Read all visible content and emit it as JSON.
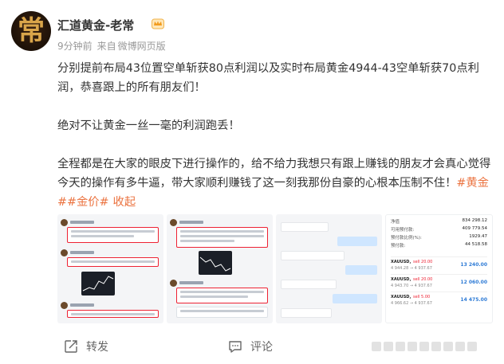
{
  "post": {
    "author": {
      "name": "汇道黄金-老常",
      "avatar_glyph": "常",
      "avatar_color": "#1d1108",
      "badge_icon": "vip-crown-icon"
    },
    "meta": {
      "time": "9分钟前",
      "source_prefix": "来自",
      "source": "微博网页版"
    },
    "paragraphs": [
      "分别提前布局43位置空单斩获80点利润以及实时布局黄金4944-43空单斩获70点利润，恭喜跟上的所有朋友们！",
      "绝对不让黄金一丝一毫的利润跑丢！",
      "全程都是在大家的眼皮下进行操作的，给不给力我想只有跟上赚钱的朋友才会真心觉得今天的操作有多牛逼，带大家顺利赚钱了这一刻我那份自豪的心根本压制不住！"
    ],
    "tags": [
      "#黄金#",
      "#金价#"
    ],
    "collapse_label": "收起",
    "accent_color": "#eb7340",
    "images": [
      {
        "kind": "chat-screenshot"
      },
      {
        "kind": "chat-screenshot"
      },
      {
        "kind": "chat-screenshot"
      },
      {
        "kind": "trading-account-screenshot",
        "account_rows": [
          {
            "key": "净值",
            "value": "834 298.12"
          },
          {
            "key": "可用预付款:",
            "value": "409 779.54"
          },
          {
            "key": "预付款比例(%):",
            "value": "1929.47"
          },
          {
            "key": "预付款:",
            "value": "44 518.58"
          }
        ],
        "positions": [
          {
            "symbol": "XAUUSD,",
            "side": "sell 20.00",
            "price": "4 944.28 → 4 937.67",
            "pnl": "13 240.00"
          },
          {
            "symbol": "XAUUSD,",
            "side": "sell 20.00",
            "price": "4 943.70 → 4 937.67",
            "pnl": "12 060.00"
          },
          {
            "symbol": "XAUUSD,",
            "side": "sell 5.00",
            "price": "4 966.62 → 4 937.67",
            "pnl": "14 475.00"
          }
        ]
      }
    ]
  },
  "actions": {
    "share_label": "转发",
    "comment_label": "评论",
    "share_icon": "share-icon",
    "comment_icon": "comment-icon",
    "like_icon": "like-icon"
  }
}
